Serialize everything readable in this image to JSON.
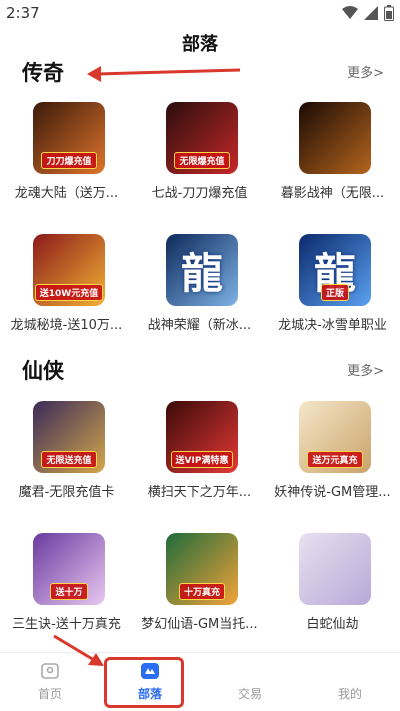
{
  "status": {
    "time": "2:37"
  },
  "page": {
    "title": "部落"
  },
  "sections": [
    {
      "title": "传奇",
      "more": "更多>",
      "games": [
        {
          "name": "龙魂大陆（送万...",
          "badge": "刀刀爆充值",
          "c1": "#3a1a0a",
          "c2": "#e0742c"
        },
        {
          "name": "七战-刀刀爆充值",
          "badge": "无限爆充值",
          "c1": "#2b0d0d",
          "c2": "#c62828"
        },
        {
          "name": "暮影战神（无限...",
          "badge": "",
          "c1": "#1a0a05",
          "c2": "#b5651d"
        },
        {
          "name": "龙城秘境-送10万...",
          "badge": "送10W元充值",
          "c1": "#8b1a1a",
          "c2": "#f2b134"
        },
        {
          "name": "战神荣耀（新冰...",
          "badge": "",
          "c1": "#0d2a5a",
          "c2": "#7fb2e5",
          "glyph": "龍"
        },
        {
          "name": "龙城决-冰雪单职业",
          "badge": "正版",
          "c1": "#0b2a6b",
          "c2": "#5aa0f0",
          "glyph": "龍"
        }
      ]
    },
    {
      "title": "仙侠",
      "more": "更多>",
      "games": [
        {
          "name": "魔君-无限充值卡",
          "badge": "无限送充值",
          "c1": "#3a2a5a",
          "c2": "#d4a74a"
        },
        {
          "name": "横扫天下之万年...",
          "badge": "送VIP满特惠",
          "c1": "#3a0a0a",
          "c2": "#e53935"
        },
        {
          "name": "妖神传说-GM管理...",
          "badge": "送万元真充",
          "c1": "#f5e6c8",
          "c2": "#c9a36a"
        },
        {
          "name": "三生诀-送十万真充",
          "badge": "送十万",
          "c1": "#6a3aa0",
          "c2": "#e8c8f0"
        },
        {
          "name": "梦幻仙语-GM当托...",
          "badge": "十万真充",
          "c1": "#1f6b3a",
          "c2": "#f2a33a"
        },
        {
          "name": "白蛇仙劫",
          "badge": "",
          "c1": "#e8e0f0",
          "c2": "#b8a8d8"
        }
      ]
    }
  ],
  "nav": [
    {
      "label": "首页",
      "icon": "home-icon"
    },
    {
      "label": "部落",
      "icon": "tribe-icon"
    },
    {
      "label": "交易",
      "icon": "trade-icon"
    },
    {
      "label": "我的",
      "icon": "profile-icon"
    }
  ],
  "colors": {
    "accent": "#2a6df0",
    "annotation": "#d9382c"
  }
}
